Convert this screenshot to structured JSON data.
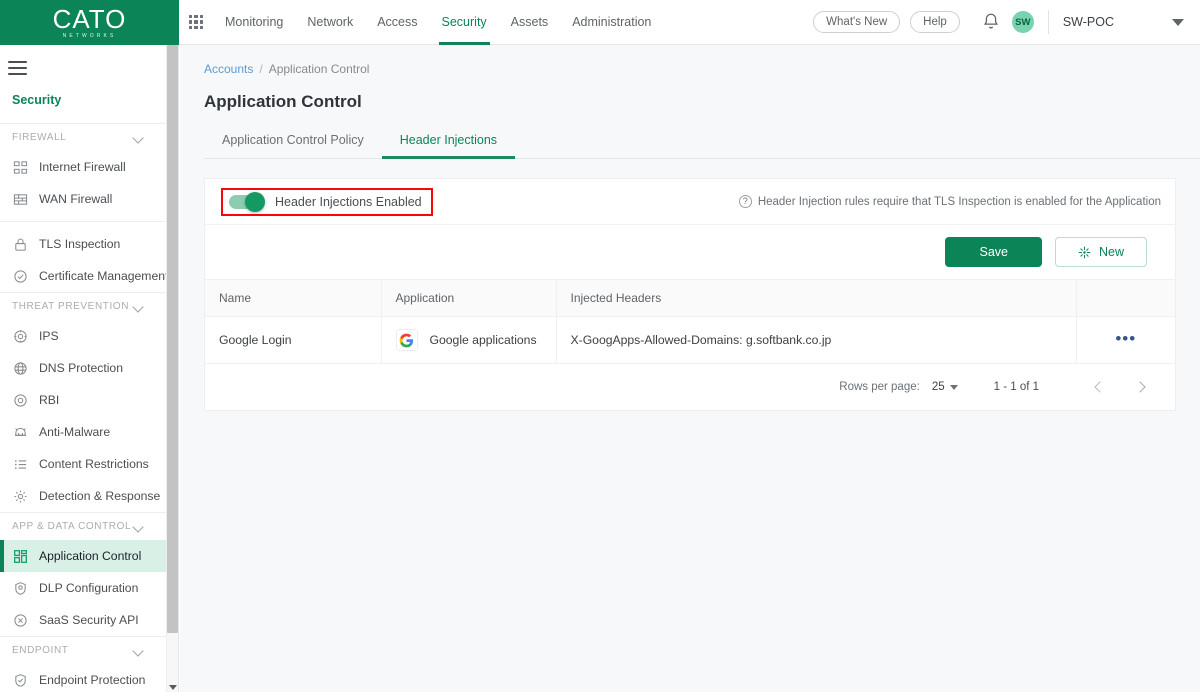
{
  "brand": {
    "name": "CATO",
    "tagline": "NETWORKS",
    "green": "#0b8457"
  },
  "topnav": {
    "apps_icon": "grid-apps-icon",
    "items": [
      {
        "label": "Monitoring",
        "active": false
      },
      {
        "label": "Network",
        "active": false
      },
      {
        "label": "Access",
        "active": false
      },
      {
        "label": "Security",
        "active": true
      },
      {
        "label": "Assets",
        "active": false
      },
      {
        "label": "Administration",
        "active": false
      }
    ],
    "whats_new": "What's New",
    "help": "Help",
    "notifications_icon": "bell-icon",
    "avatar_initials": "SW",
    "account": "SW-POC"
  },
  "sidebar": {
    "menu_icon": "hamburger-icon",
    "title": "Security",
    "sections": [
      {
        "label": "FIREWALL",
        "items": [
          {
            "label": "Internet Firewall",
            "icon": "internet-firewall-icon",
            "active": false
          },
          {
            "label": "WAN Firewall",
            "icon": "wan-firewall-icon",
            "active": false
          }
        ]
      },
      {
        "label": "",
        "items": [
          {
            "label": "TLS Inspection",
            "icon": "lock-icon",
            "active": false
          },
          {
            "label": "Certificate Management",
            "icon": "certificate-check-icon",
            "active": false
          }
        ]
      },
      {
        "label": "THREAT PREVENTION",
        "items": [
          {
            "label": "IPS",
            "icon": "ips-target-icon",
            "active": false
          },
          {
            "label": "DNS Protection",
            "icon": "globe-icon",
            "active": false
          },
          {
            "label": "RBI",
            "icon": "rbi-circle-icon",
            "active": false
          },
          {
            "label": "Anti-Malware",
            "icon": "anti-malware-icon",
            "active": false
          },
          {
            "label": "Content Restrictions",
            "icon": "list-icon",
            "active": false
          },
          {
            "label": "Detection & Response",
            "icon": "gear-icon",
            "active": false
          }
        ]
      },
      {
        "label": "APP & DATA CONTROL",
        "items": [
          {
            "label": "Application Control",
            "icon": "app-control-icon",
            "active": true
          },
          {
            "label": "DLP Configuration",
            "icon": "shield-dlp-icon",
            "active": false
          },
          {
            "label": "SaaS Security API",
            "icon": "saas-api-icon",
            "active": false
          }
        ]
      },
      {
        "label": "ENDPOINT",
        "items": [
          {
            "label": "Endpoint Protection",
            "icon": "endpoint-shield-icon",
            "active": false
          }
        ]
      }
    ]
  },
  "breadcrumb": {
    "root": "Accounts",
    "separator": "/",
    "current": "Application Control"
  },
  "page": {
    "title": "Application Control"
  },
  "tabs": [
    {
      "label": "Application Control Policy",
      "active": false
    },
    {
      "label": "Header Injections",
      "active": true
    }
  ],
  "toggle": {
    "label": "Header Injections Enabled",
    "enabled": true,
    "highlight_color": "#f90606"
  },
  "note": {
    "icon": "question-circle-icon",
    "text": "Header Injection rules require that TLS Inspection is enabled for the Application"
  },
  "actions": {
    "save_label": "Save",
    "new_label": "New",
    "new_icon": "sparkle-icon"
  },
  "table": {
    "columns": [
      "Name",
      "Application",
      "Injected Headers"
    ],
    "rows": [
      {
        "name": "Google Login",
        "application": "Google applications",
        "app_icon": "google-logo-icon",
        "injected_headers": "X-GoogApps-Allowed-Domains: g.softbank.co.jp",
        "more_icon": "more-options-icon"
      }
    ]
  },
  "pagination": {
    "rows_per_page_label": "Rows per page:",
    "rows_per_page_value": "25",
    "range": "1 - 1 of 1",
    "prev_icon": "chevron-left-icon",
    "next_icon": "chevron-right-icon"
  }
}
